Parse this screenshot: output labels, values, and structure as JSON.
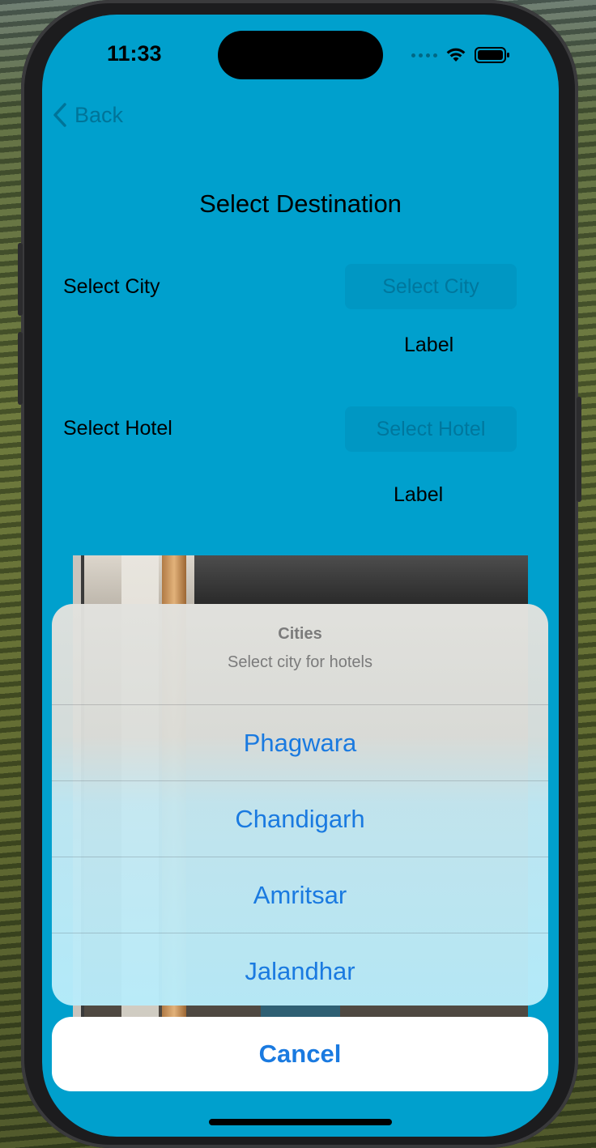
{
  "status_bar": {
    "time": "11:33"
  },
  "nav": {
    "back_label": "Back"
  },
  "page": {
    "title": "Select Destination",
    "city_row_label": "Select City",
    "city_button": "Select City",
    "city_value_label": "Label",
    "hotel_row_label": "Select Hotel",
    "hotel_button": "Select Hotel",
    "hotel_value_label": "Label"
  },
  "action_sheet": {
    "title": "Cities",
    "message": "Select city for hotels",
    "options": [
      "Phagwara",
      "Chandigarh",
      "Amritsar",
      "Jalandhar"
    ],
    "cancel_label": "Cancel"
  },
  "colors": {
    "screen_background": "#00a0cd",
    "action_tint": "#1a7ae0"
  }
}
